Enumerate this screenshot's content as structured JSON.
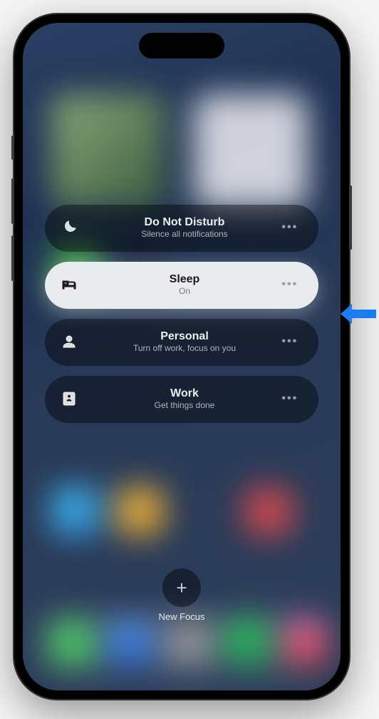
{
  "focusModes": [
    {
      "key": "dnd",
      "title": "Do Not Disturb",
      "subtitle": "Silence all notifications",
      "active": false
    },
    {
      "key": "sleep",
      "title": "Sleep",
      "subtitle": "On",
      "active": true
    },
    {
      "key": "personal",
      "title": "Personal",
      "subtitle": "Turn off work, focus on you",
      "active": false
    },
    {
      "key": "work",
      "title": "Work",
      "subtitle": "Get things done",
      "active": false
    }
  ],
  "newFocusLabel": "New Focus",
  "calloutTarget": "sleep"
}
